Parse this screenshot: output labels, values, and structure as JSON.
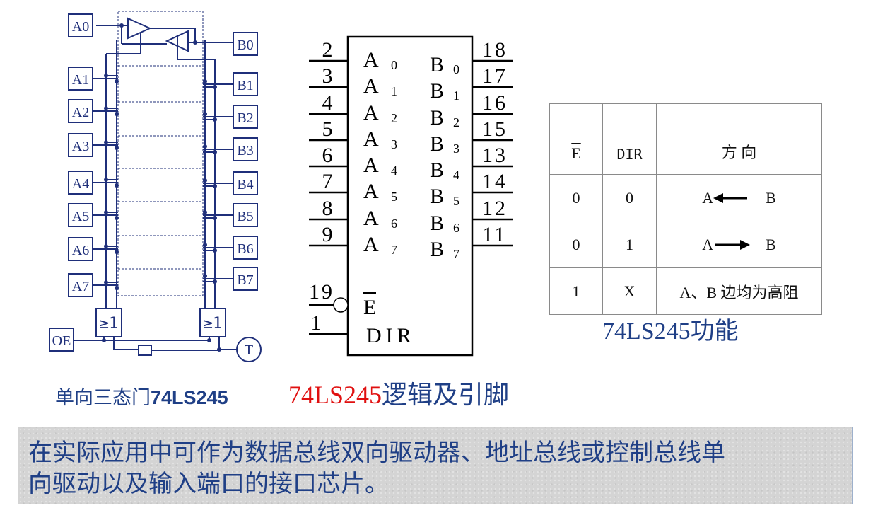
{
  "schematic": {
    "a_pins": [
      "A0",
      "A1",
      "A2",
      "A3",
      "A4",
      "A5",
      "A6",
      "A7"
    ],
    "b_pins": [
      "B0",
      "B1",
      "B2",
      "B3",
      "B4",
      "B5",
      "B6",
      "B7"
    ],
    "oe_label": "OE",
    "t_label": "T",
    "gate_label": "≥1",
    "caption_prefix": "单向三态门",
    "caption_part": "74LS245"
  },
  "chip": {
    "left_pins": [
      {
        "num": "2",
        "name": "A",
        "sub": "0"
      },
      {
        "num": "3",
        "name": "A",
        "sub": "1"
      },
      {
        "num": "4",
        "name": "A",
        "sub": "2"
      },
      {
        "num": "5",
        "name": "A",
        "sub": "3"
      },
      {
        "num": "6",
        "name": "A",
        "sub": "4"
      },
      {
        "num": "7",
        "name": "A",
        "sub": "5"
      },
      {
        "num": "8",
        "name": "A",
        "sub": "6"
      },
      {
        "num": "9",
        "name": "A",
        "sub": "7"
      }
    ],
    "right_pins": [
      {
        "num": "18",
        "name": "B",
        "sub": "0"
      },
      {
        "num": "17",
        "name": "B",
        "sub": "1"
      },
      {
        "num": "16",
        "name": "B",
        "sub": "2"
      },
      {
        "num": "15",
        "name": "B",
        "sub": "3"
      },
      {
        "num": "13",
        "name": "B",
        "sub": "4"
      },
      {
        "num": "14",
        "name": "B",
        "sub": "5"
      },
      {
        "num": "12",
        "name": "B",
        "sub": "6"
      },
      {
        "num": "11",
        "name": "B",
        "sub": "7"
      }
    ],
    "enable_pin": {
      "num": "19",
      "name": "E"
    },
    "dir_pin": {
      "num": "1",
      "name": "DIR"
    },
    "caption_part": "74LS245",
    "caption_rest": "逻辑及引脚"
  },
  "function_table": {
    "headers": [
      "E",
      "DIR",
      "方 向"
    ],
    "rows": [
      {
        "e": "0",
        "dir": "0",
        "dir_from": "A",
        "dir_to": "B",
        "arrow": "left"
      },
      {
        "e": "0",
        "dir": "1",
        "dir_from": "A",
        "dir_to": "B",
        "arrow": "right"
      },
      {
        "e": "1",
        "dir": "X",
        "text": "A、B 边均为高阻"
      }
    ],
    "caption": "74LS245功能"
  },
  "note": {
    "line1": "在实际应用中可作为数据总线双向驱动器、地址总线或控制总线单",
    "line2": "向驱动以及输入端口的接口芯片。"
  },
  "colors": {
    "schematic": "#1f2f7a",
    "caption_blue": "#1f3f86",
    "caption_red": "#e01010",
    "note_bg": "#d4d4d4"
  }
}
